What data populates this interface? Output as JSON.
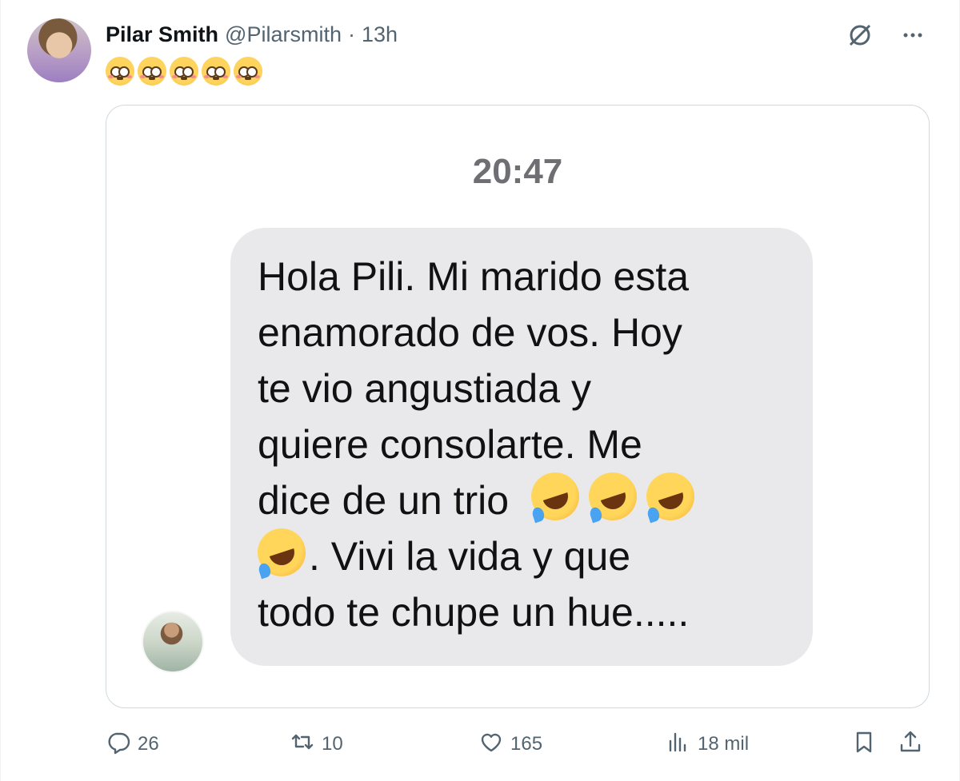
{
  "tweet": {
    "author_name": "Pilar Smith",
    "author_handle": "@Pilarsmith",
    "separator": "·",
    "timestamp": "13h",
    "text_emojis": "😳😳😳😳😳"
  },
  "media": {
    "message_time": "20:47",
    "message_lines": [
      "Hola Pili. Mi marido esta",
      "enamorado de vos. Hoy",
      "te vio angustiada y",
      "quiere consolarte. Me",
      "dice de un trio",
      ". Vivi la vida y que",
      "todo te chupe un hue....."
    ],
    "laugh_emoji": "🤣"
  },
  "actions": {
    "replies": "26",
    "retweets": "10",
    "likes": "165",
    "views": "18 mil"
  },
  "icons": {
    "top_right": [
      "grok-icon",
      "more-icon"
    ],
    "actions": [
      "reply-icon",
      "retweet-icon",
      "like-icon",
      "views-icon",
      "bookmark-icon",
      "share-icon"
    ]
  }
}
